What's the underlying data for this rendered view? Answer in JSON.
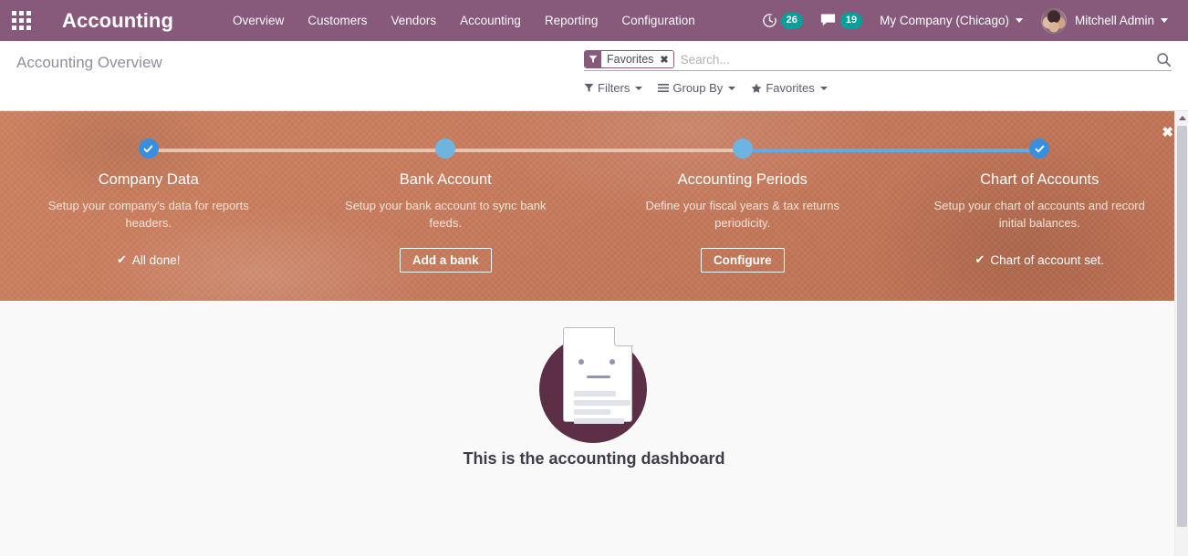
{
  "navbar": {
    "apps_icon": "apps-grid-icon",
    "brand": "Accounting",
    "menu": [
      {
        "label": "Overview"
      },
      {
        "label": "Customers"
      },
      {
        "label": "Vendors"
      },
      {
        "label": "Accounting"
      },
      {
        "label": "Reporting"
      },
      {
        "label": "Configuration"
      }
    ],
    "activities": {
      "icon": "clock-icon",
      "count": "26"
    },
    "messages": {
      "icon": "chat-bubble-icon",
      "count": "19"
    },
    "company": "My Company (Chicago)",
    "user": "Mitchell Admin",
    "avatar_icon": "user-avatar"
  },
  "control_panel": {
    "breadcrumb": "Accounting Overview",
    "search": {
      "facet_icon": "filter-funnel-icon",
      "facet_label": "Favorites",
      "facet_remove": "✖",
      "placeholder": "Search...",
      "value": "",
      "toggle_icon": "search-icon"
    },
    "dropdowns": [
      {
        "label": "Filters",
        "icon": "filter-funnel-icon"
      },
      {
        "label": "Group By",
        "icon": "hamburger-lines-icon"
      },
      {
        "label": "Favorites",
        "icon": "star-icon"
      }
    ]
  },
  "onboarding": {
    "close_label": "✖",
    "steps": [
      {
        "title": "Company Data",
        "description": "Setup your company's data for reports headers.",
        "state": "done",
        "action_type": "done",
        "action_label": "All done!",
        "line_left": "none",
        "line_right": "pale"
      },
      {
        "title": "Bank Account",
        "description": "Setup your bank account to sync bank feeds.",
        "state": "todo",
        "action_type": "button",
        "action_label": "Add a bank",
        "line_left": "pale",
        "line_right": "pale"
      },
      {
        "title": "Accounting Periods",
        "description": "Define your fiscal years & tax returns periodicity.",
        "state": "todo",
        "action_type": "button",
        "action_label": "Configure",
        "line_left": "pale",
        "line_right": "blue"
      },
      {
        "title": "Chart of Accounts",
        "description": "Setup your chart of accounts and record initial balances.",
        "state": "done",
        "action_type": "done",
        "action_label": "Chart of account set.",
        "line_left": "blue",
        "line_right": "none"
      }
    ]
  },
  "content": {
    "empty_illustration": "document-face-icon",
    "empty_title": "This is the accounting dashboard"
  },
  "scrollbar": {
    "up_icon": "scroll-up-arrow-icon"
  },
  "colors": {
    "brand_purple": "#875A7B",
    "badge_teal": "#00A09D",
    "banner_terracotta": "#C87A5C",
    "progress_blue": "#3A8FDC",
    "progress_pale": "#E8C3B2",
    "empty_circle": "#5C2F47"
  }
}
